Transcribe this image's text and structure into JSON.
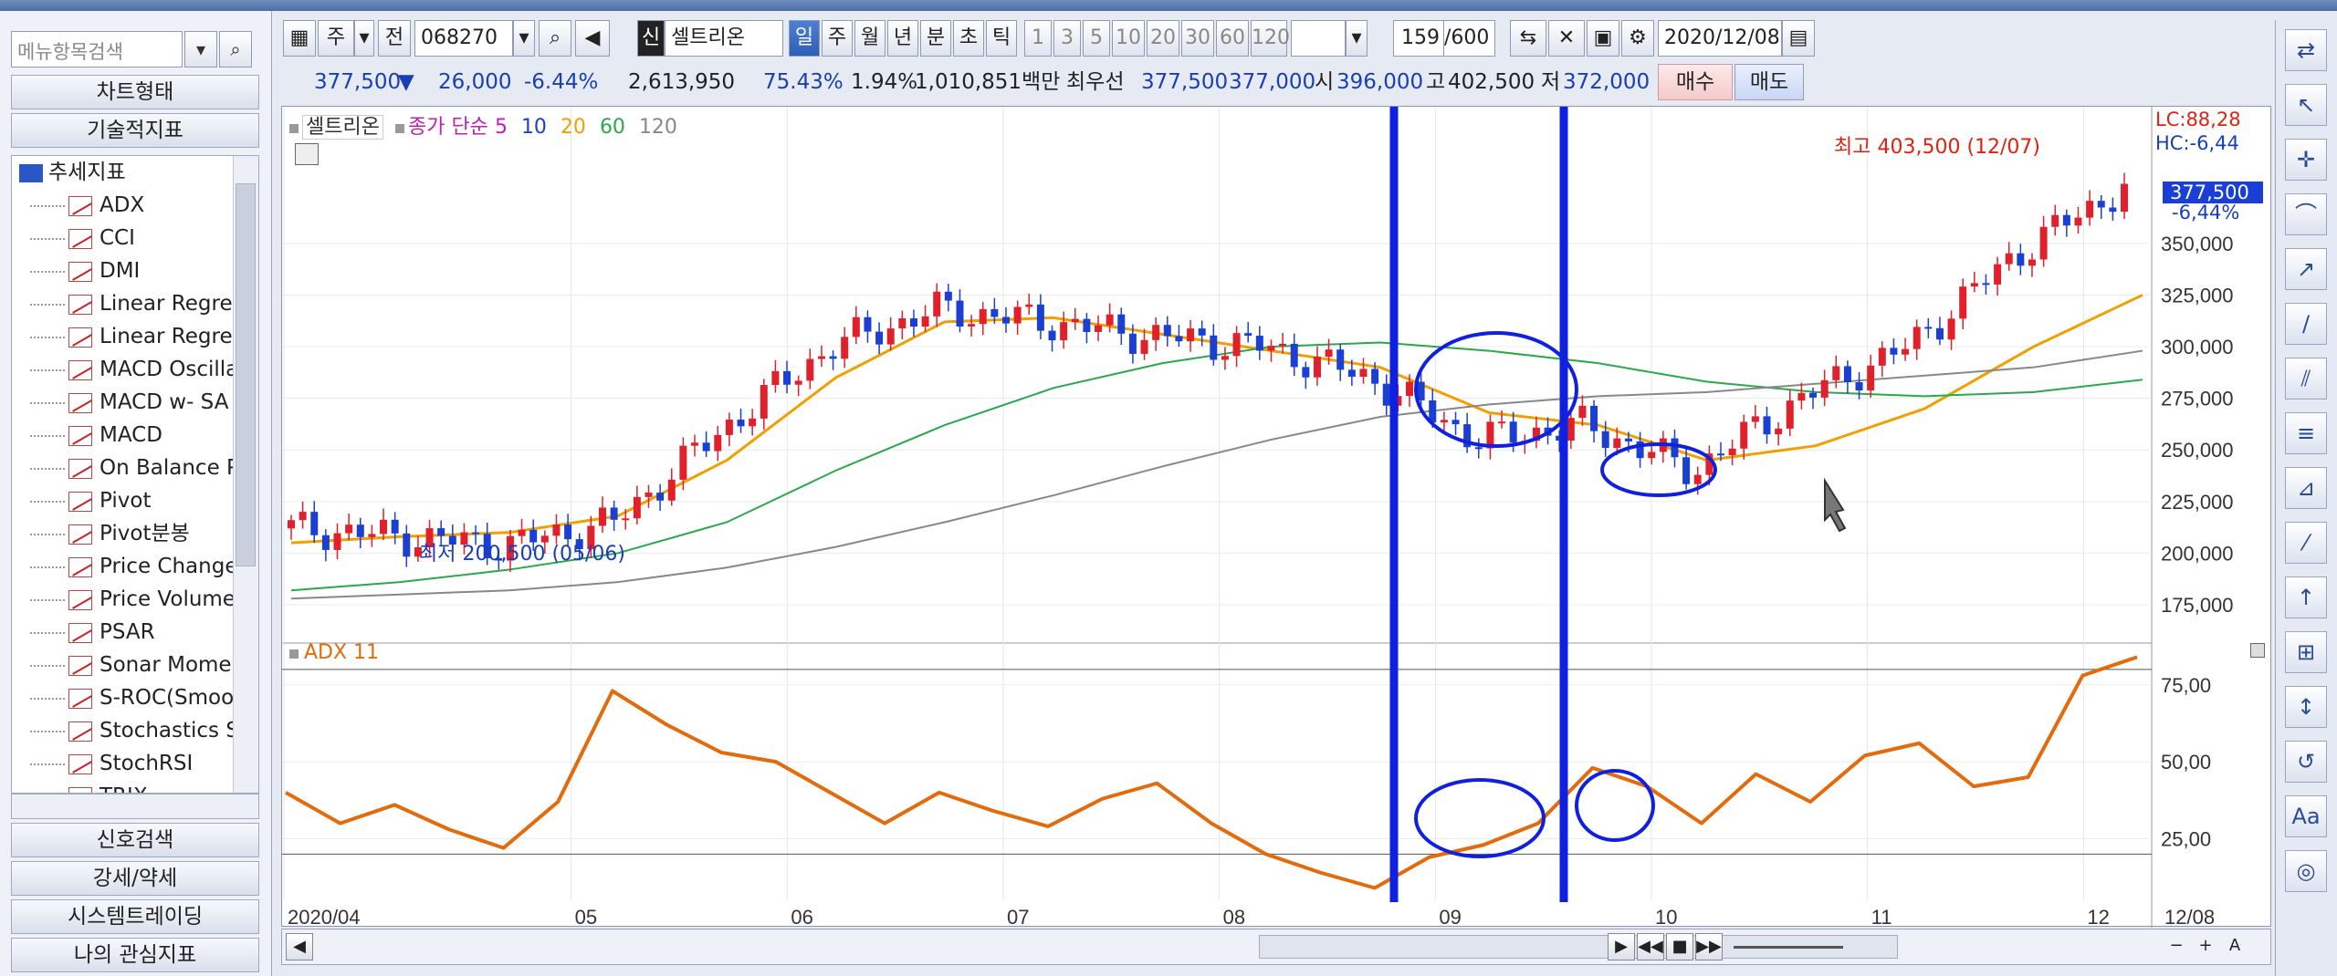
{
  "left_panel": {
    "search_placeholder": "메뉴항목검색",
    "headers": [
      "차트형태",
      "기술적지표"
    ],
    "tree_root": "추세지표",
    "tree_items": [
      "ADX",
      "CCI",
      "DMI",
      "Linear Regres",
      "Linear Regres",
      "MACD Oscilla",
      "MACD w- SA",
      "MACD",
      "On Balance P",
      "Pivot",
      "Pivot분봉",
      "Price Change",
      "Price Volume",
      "PSAR",
      "Sonar Momer",
      "S-ROC(Smoo",
      "Stochastics S",
      "StochRSI",
      "TRIX"
    ],
    "bottom_buttons": [
      "신호검색",
      "강세/약세",
      "시스템트레이딩",
      "나의 관심지표"
    ]
  },
  "toolbar": {
    "period_label": "주",
    "prev_label": "전",
    "code": "068270",
    "stock_tag": "신",
    "stock_name": "셀트리온",
    "intervals": [
      "일",
      "주",
      "월",
      "년",
      "분",
      "초",
      "틱"
    ],
    "selected_interval": "일",
    "nums": [
      "1",
      "3",
      "5",
      "10",
      "20",
      "30",
      "60",
      "120"
    ],
    "count": "159",
    "count_total": "/600",
    "date": "2020/12/08"
  },
  "quote": {
    "price": "377,500",
    "arrow": "▼",
    "change": "26,000",
    "pct": "-6.44%",
    "volume": "2,613,950",
    "ratio": "75.43%",
    "turnover_pct": "1.94%",
    "amount": "1,010,851백만",
    "best_label": "최우선",
    "best_ask": "377,500",
    "best_bid": "377,000",
    "open_label": "시",
    "open": "396,000",
    "high_label": "고",
    "high": "402,500",
    "low_label": "저",
    "low": "372,000",
    "buy_label": "매수",
    "sell_label": "매도"
  },
  "chart_legend": {
    "stock": "셀트리온",
    "ma_label": "종가 단순",
    "ma_periods": [
      "5",
      "10",
      "20",
      "60",
      "120"
    ],
    "ma_colors": [
      "#c21eb0",
      "#1b3fd0",
      "#f0a000",
      "#2aa84a",
      "#888888"
    ],
    "indicator": "ADX 11",
    "lc": "LC:88,28",
    "hc": "HC:-6,44",
    "high_annot": "최고 403,500 (12/07)",
    "low_annot": "최저 200,500 (05/06)",
    "current_price": "377,500",
    "current_pct": "-6,44%"
  },
  "chart_data": [
    {
      "type": "candlestick",
      "x": [
        "2020/04",
        "05",
        "06",
        "07",
        "08",
        "09",
        "10",
        "11",
        "12"
      ],
      "yticks": [
        "350,000",
        "325,000",
        "300,000",
        "275,000",
        "250,000",
        "225,000",
        "200,000",
        "175,000"
      ],
      "ylim": [
        160000,
        410000
      ],
      "close_approx": [
        212000,
        208000,
        204000,
        215000,
        260000,
        300000,
        318000,
        312000,
        305000,
        300000,
        285000,
        255000,
        262000,
        240000,
        275000,
        300000,
        345000,
        377500
      ],
      "ma_series": [
        {
          "name": "20",
          "values": [
            205000,
            208000,
            210000,
            218000,
            245000,
            285000,
            312000,
            314000,
            306000,
            298000,
            290000,
            268000,
            262000,
            245000,
            252000,
            270000,
            300000,
            325000
          ]
        },
        {
          "name": "60",
          "values": [
            182000,
            186000,
            192000,
            200000,
            215000,
            240000,
            262000,
            280000,
            292000,
            300000,
            302000,
            298000,
            292000,
            283000,
            278000,
            276000,
            278000,
            284000
          ]
        },
        {
          "name": "120",
          "values": [
            178000,
            180000,
            182000,
            186000,
            193000,
            203000,
            215000,
            228000,
            242000,
            255000,
            266000,
            272000,
            276000,
            278000,
            282000,
            286000,
            290000,
            298000
          ]
        }
      ]
    },
    {
      "type": "line",
      "title": "ADX 11",
      "yticks": [
        "75,00",
        "50,00",
        "25,00"
      ],
      "ylim": [
        5,
        85
      ],
      "values": [
        40,
        30,
        36,
        28,
        22,
        37,
        73,
        62,
        53,
        50,
        40,
        30,
        40,
        34,
        29,
        38,
        43,
        30,
        20,
        14,
        9,
        19,
        23,
        30,
        48,
        42,
        30,
        46,
        37,
        52,
        56,
        42,
        45,
        78,
        84
      ]
    }
  ],
  "x_axis_end": "12/08",
  "right_tools": [
    "cross-icon",
    "pointer-icon",
    "crosshair-icon",
    "line-icon",
    "trend-icon",
    "ray-icon",
    "channel-icon",
    "fib-icon",
    "gann-icon",
    "fan-icon",
    "arrow-icon",
    "grid-icon",
    "measure-icon",
    "reset-icon",
    "text-icon",
    "globe-icon"
  ]
}
